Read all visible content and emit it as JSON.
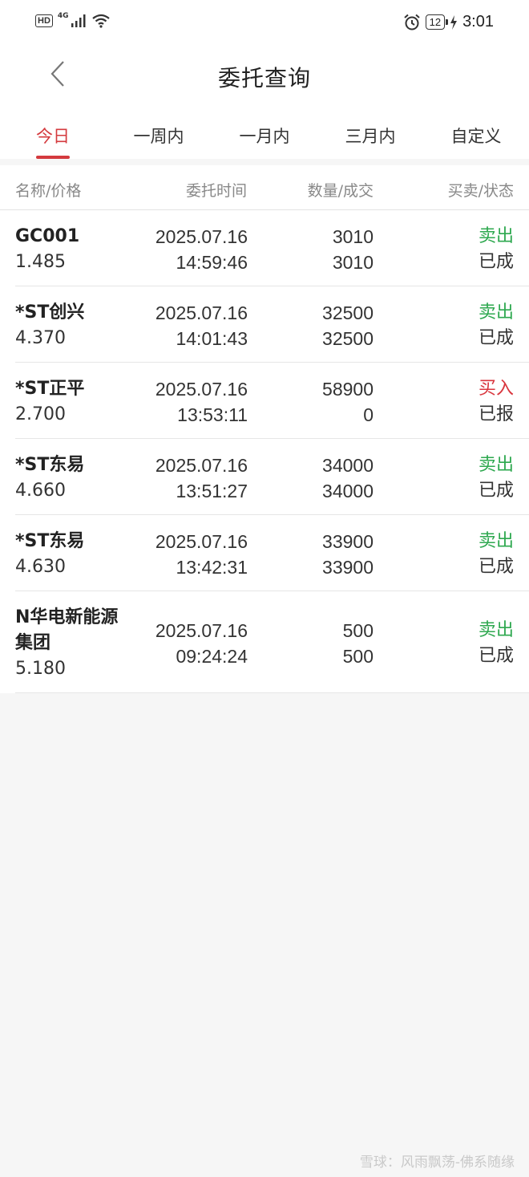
{
  "status_bar": {
    "left_badges": [
      "HD",
      "4G"
    ],
    "battery": "12",
    "time": "3:01"
  },
  "header": {
    "title": "委托查询"
  },
  "tabs": [
    {
      "label": "今日",
      "active": true
    },
    {
      "label": "一周内",
      "active": false
    },
    {
      "label": "一月内",
      "active": false
    },
    {
      "label": "三月内",
      "active": false
    },
    {
      "label": "自定义",
      "active": false
    }
  ],
  "columns": {
    "name_price": "名称/价格",
    "time": "委托时间",
    "qty": "数量/成交",
    "side_status": "买卖/状态"
  },
  "orders": [
    {
      "name": "GC001",
      "price": "1.485",
      "date": "2025.07.16",
      "time": "14:59:46",
      "qty": "3010",
      "filled": "3010",
      "side": "卖出",
      "status": "已成"
    },
    {
      "name": "*ST创兴",
      "price": "4.370",
      "date": "2025.07.16",
      "time": "14:01:43",
      "qty": "32500",
      "filled": "32500",
      "side": "卖出",
      "status": "已成"
    },
    {
      "name": "*ST正平",
      "price": "2.700",
      "date": "2025.07.16",
      "time": "13:53:11",
      "qty": "58900",
      "filled": "0",
      "side": "买入",
      "status": "已报"
    },
    {
      "name": "*ST东易",
      "price": "4.660",
      "date": "2025.07.16",
      "time": "13:51:27",
      "qty": "34000",
      "filled": "34000",
      "side": "卖出",
      "status": "已成"
    },
    {
      "name": "*ST东易",
      "price": "4.630",
      "date": "2025.07.16",
      "time": "13:42:31",
      "qty": "33900",
      "filled": "33900",
      "side": "卖出",
      "status": "已成"
    },
    {
      "name": "N华电新能源集团",
      "price": "5.180",
      "date": "2025.07.16",
      "time": "09:24:24",
      "qty": "500",
      "filled": "500",
      "side": "卖出",
      "status": "已成"
    }
  ],
  "colors": {
    "accent": "#d43a3e",
    "sell": "#2ea84f",
    "buy": "#d9363e"
  },
  "watermark": "雪球：风雨飘荡-佛系随缘"
}
